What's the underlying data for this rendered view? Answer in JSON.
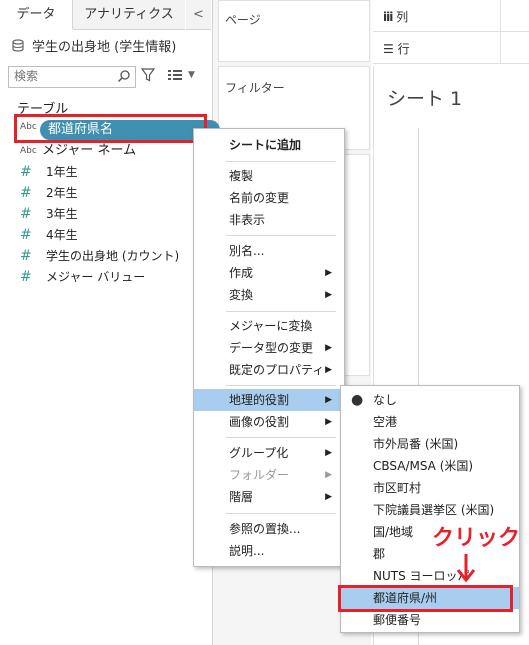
{
  "left_pane": {
    "tabs": {
      "data": "データ",
      "analytics": "アナリティクス",
      "collapse": "<"
    },
    "datasource": "学生の出身地 (学生情報)",
    "search_placeholder": "検索",
    "section_title": "テーブル",
    "fields": [
      {
        "type": "Abc",
        "name": "都道府県名"
      },
      {
        "type": "Abc",
        "name": "メジャー ネーム"
      },
      {
        "type": "#",
        "name": "1年生"
      },
      {
        "type": "#",
        "name": "2年生"
      },
      {
        "type": "#",
        "name": "3年生"
      },
      {
        "type": "#",
        "name": "4年生"
      },
      {
        "type": "#",
        "name": "学生の出身地 (カウント)"
      },
      {
        "type": "#",
        "name": "メジャー バリュー"
      }
    ]
  },
  "cards": {
    "pages": "ページ",
    "filters": "フィルター"
  },
  "shelves": {
    "columns": "列",
    "rows": "行"
  },
  "sheet": {
    "title": "シート 1"
  },
  "context_menu": {
    "items": [
      "シートに追加",
      "複製",
      "名前の変更",
      "非表示",
      "別名...",
      "作成",
      "変換",
      "メジャーに変換",
      "データ型の変更",
      "既定のプロパティ",
      "地理的役割",
      "画像の役割",
      "グループ化",
      "フォルダー",
      "階層",
      "参照の置換...",
      "説明..."
    ]
  },
  "geo_submenu": {
    "items": [
      "なし",
      "空港",
      "市外局番 (米国)",
      "CBSA/MSA (米国)",
      "市区町村",
      "下院議員選挙区 (米国)",
      "国/地域",
      "郡",
      "NUTS ヨーロッパ",
      "都道府県/州",
      "郵便番号"
    ]
  },
  "annotation": {
    "click_label": "クリック"
  },
  "colors": {
    "highlight": "#e8202a",
    "pill": "#3f8fb0",
    "menu_active": "#a9cdee"
  }
}
